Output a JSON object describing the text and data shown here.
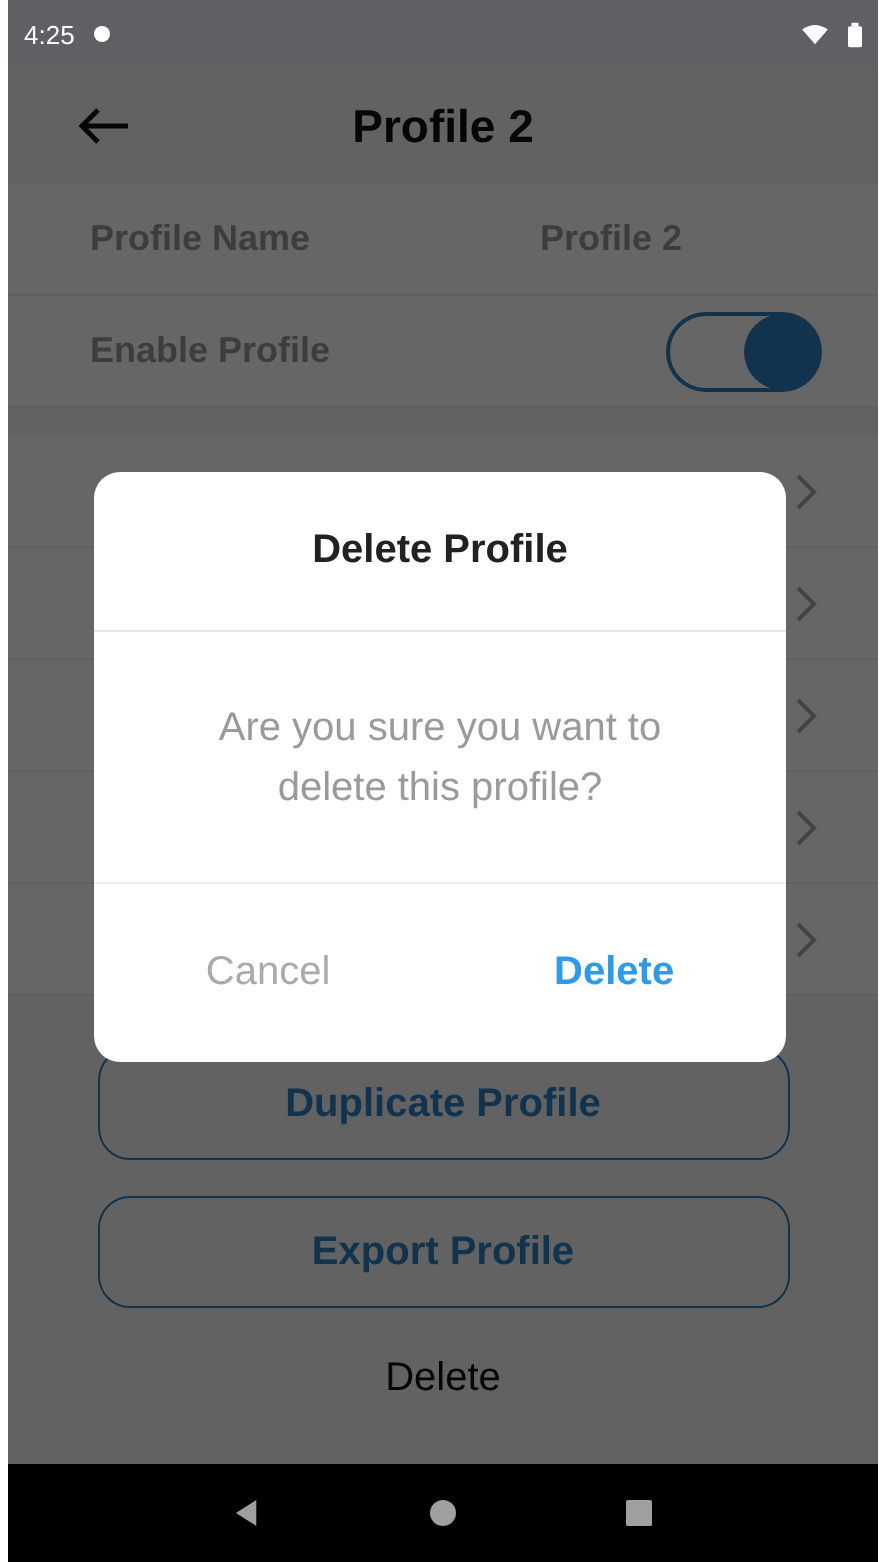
{
  "status_bar": {
    "time": "4:25"
  },
  "header": {
    "title": "Profile 2"
  },
  "settings": [
    {
      "kind": "value",
      "label": "Profile Name",
      "value": "Profile 2"
    },
    {
      "kind": "toggle",
      "label": "Enable Profile",
      "on": true
    }
  ],
  "menu_rows": [
    {
      "kind": "link"
    },
    {
      "kind": "link"
    },
    {
      "kind": "link"
    },
    {
      "kind": "link"
    },
    {
      "kind": "link"
    }
  ],
  "buttons": [
    "Duplicate Profile",
    "Export Profile"
  ],
  "delete_link": "Delete",
  "dialog": {
    "title": "Delete Profile",
    "message": "Are you sure you want to delete this profile?",
    "cancel": "Cancel",
    "confirm": "Delete"
  }
}
